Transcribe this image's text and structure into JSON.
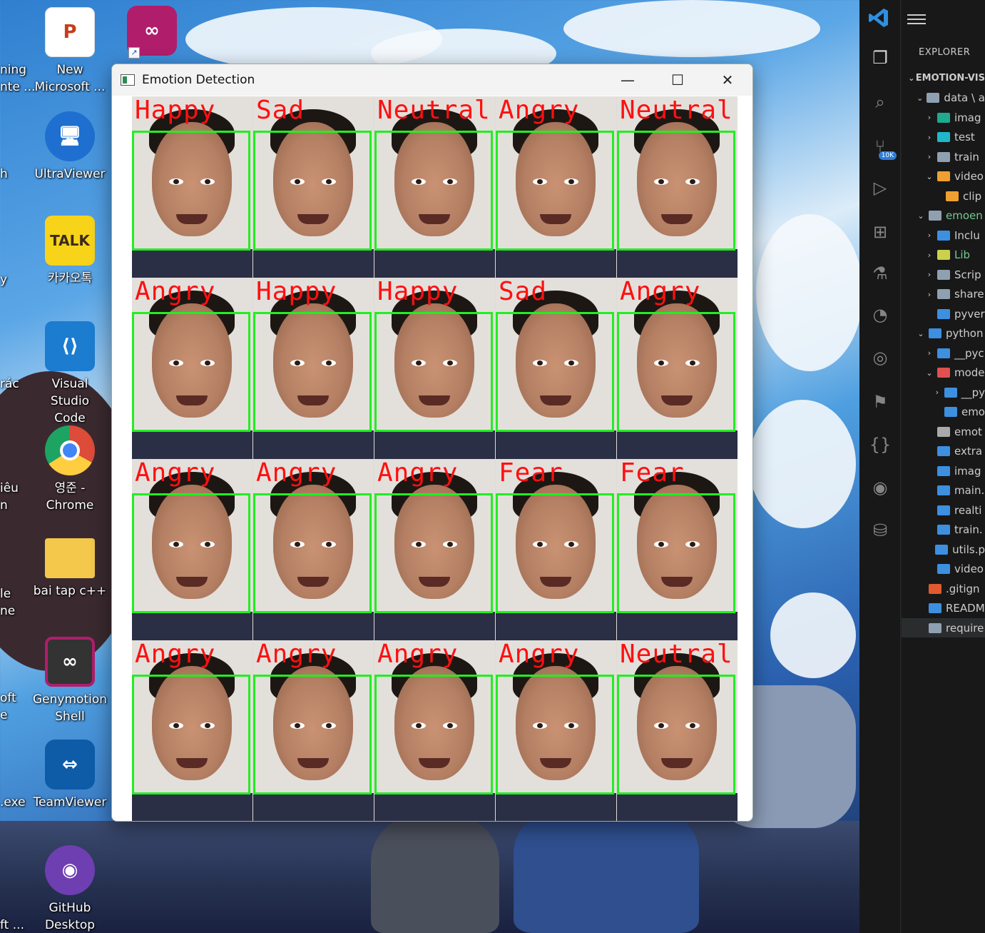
{
  "desktop": {
    "icons": [
      {
        "name": "new-microsoft-powerpoint-icon",
        "label": "New\nMicrosoft ...",
        "glyph": "P",
        "color": "#c43e1c"
      },
      {
        "name": "genymotion-top-icon",
        "label": "",
        "glyph": "∞",
        "color": "#b01e6b"
      },
      {
        "name": "ultraviewer-icon",
        "label": "UltraViewer",
        "glyph": "🖥",
        "color": "#1e6fd0"
      },
      {
        "name": "kakaotalk-icon",
        "label": "카카오톡",
        "glyph": "TALK",
        "color": "#f7d31a"
      },
      {
        "name": "vscode-icon",
        "label": "Visual Studio\nCode",
        "glyph": "⟨⟩",
        "color": "#1c7ccf"
      },
      {
        "name": "chrome-icon",
        "label": "영준 -\nChrome",
        "glyph": "●",
        "color": "#dd4b39"
      },
      {
        "name": "bai-tap-folder-icon",
        "label": "bai tap c++",
        "glyph": "",
        "color": "#f3c84b"
      },
      {
        "name": "genymotion-shell-icon",
        "label": "Genymotion\nShell",
        "glyph": "∞",
        "color": "#b01e6b"
      },
      {
        "name": "teamviewer-icon",
        "label": "TeamViewer",
        "glyph": "⇔",
        "color": "#0e5ba8"
      },
      {
        "name": "github-desktop-icon",
        "label": "GitHub\nDesktop",
        "glyph": "◉",
        "color": "#6e3fb0"
      }
    ],
    "partial_labels": [
      "ning",
      "nte ...",
      "h",
      "y",
      "rác",
      "iêu",
      "n",
      "le",
      "ne",
      "oft",
      "e",
      ".exe",
      "ft ..."
    ]
  },
  "window": {
    "title": "Emotion Detection",
    "controls": {
      "minimize": "—",
      "maximize": "☐",
      "close": "✕"
    },
    "faces": [
      "Happy",
      "Sad",
      "Neutral",
      "Angry",
      "Neutral",
      "Angry",
      "Happy",
      "Happy",
      "Sad",
      "Angry",
      "Angry",
      "Angry",
      "Angry",
      "Fear",
      "Fear",
      "Angry",
      "Angry",
      "Angry",
      "Angry",
      "Neutral"
    ]
  },
  "vscode": {
    "explorer_title": "EXPLORER",
    "activity": [
      "explorer",
      "search",
      "source-control",
      "run-debug",
      "extensions",
      "testing",
      "git-graph",
      "remote",
      "bookmarks",
      "json",
      "github",
      "database"
    ],
    "source_control_badge": "10K",
    "tree": [
      {
        "label": "EMOTION-VIS",
        "level": 0,
        "chev": "⌄",
        "root": true,
        "color": "#ccc"
      },
      {
        "label": "data \\ a",
        "level": 1,
        "chev": "⌄",
        "icon": "#8fa0b0"
      },
      {
        "label": "imag",
        "level": 2,
        "chev": "›",
        "icon": "#1fa98e"
      },
      {
        "label": "test",
        "level": 2,
        "chev": "›",
        "icon": "#1fb8c9"
      },
      {
        "label": "train",
        "level": 2,
        "chev": "›",
        "icon": "#8fa0b0"
      },
      {
        "label": "video",
        "level": 2,
        "chev": "⌄",
        "icon": "#f0a030"
      },
      {
        "label": "clip",
        "level": 3,
        "chev": "",
        "icon": "#f0a030"
      },
      {
        "label": "emoen",
        "level": 1,
        "chev": "⌄",
        "icon": "#8fa0b0",
        "color": "#73c991"
      },
      {
        "label": "Inclu",
        "level": 2,
        "chev": "›",
        "icon": "#3d8fe0"
      },
      {
        "label": "Lib",
        "level": 2,
        "chev": "›",
        "icon": "#c9d24a",
        "color": "#73c991"
      },
      {
        "label": "Scrip",
        "level": 2,
        "chev": "›",
        "icon": "#8fa0b0"
      },
      {
        "label": "share",
        "level": 2,
        "chev": "›",
        "icon": "#8fa0b0"
      },
      {
        "label": "pyver",
        "level": 2,
        "chev": "",
        "icon": "#3d8fe0"
      },
      {
        "label": "python",
        "level": 1,
        "chev": "⌄",
        "icon": "#3d8fe0"
      },
      {
        "label": "__pyc",
        "level": 2,
        "chev": "›",
        "icon": "#3d8fe0"
      },
      {
        "label": "mode",
        "level": 2,
        "chev": "⌄",
        "icon": "#e05050"
      },
      {
        "label": "__py",
        "level": 3,
        "chev": "›",
        "icon": "#3d8fe0"
      },
      {
        "label": "emo",
        "level": 3,
        "chev": "",
        "icon": "#3d8fe0"
      },
      {
        "label": "emot",
        "level": 2,
        "chev": "",
        "icon": "#aaa"
      },
      {
        "label": "extra",
        "level": 2,
        "chev": "",
        "icon": "#3d8fe0"
      },
      {
        "label": "imag",
        "level": 2,
        "chev": "",
        "icon": "#3d8fe0"
      },
      {
        "label": "main.",
        "level": 2,
        "chev": "",
        "icon": "#3d8fe0"
      },
      {
        "label": "realti",
        "level": 2,
        "chev": "",
        "icon": "#3d8fe0"
      },
      {
        "label": "train.",
        "level": 2,
        "chev": "",
        "icon": "#3d8fe0"
      },
      {
        "label": "utils.p",
        "level": 2,
        "chev": "",
        "icon": "#3d8fe0"
      },
      {
        "label": "video",
        "level": 2,
        "chev": "",
        "icon": "#3d8fe0"
      },
      {
        "label": ".gitign",
        "level": 1,
        "chev": "",
        "icon": "#e05a2e"
      },
      {
        "label": "READM",
        "level": 1,
        "chev": "",
        "icon": "#3d8fe0"
      },
      {
        "label": "require",
        "level": 1,
        "chev": "",
        "icon": "#8fa0b0",
        "selected": true
      }
    ]
  }
}
